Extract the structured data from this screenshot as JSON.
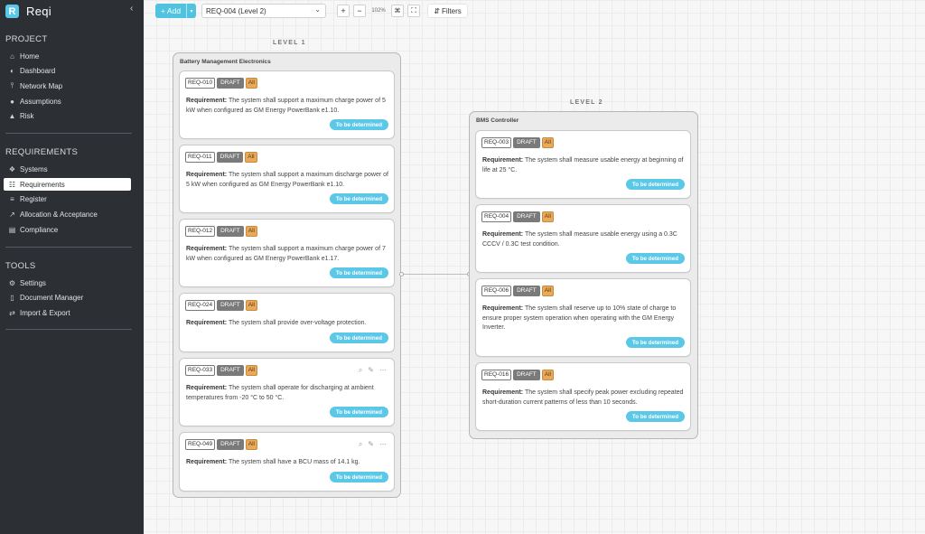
{
  "app": {
    "name": "Reqi",
    "logo_letter": "R"
  },
  "sidebar": {
    "collapse_icon": "chevron-left-icon",
    "sections": [
      {
        "title": "PROJECT",
        "items": [
          {
            "label": "Home",
            "icon": "home-icon"
          },
          {
            "label": "Dashboard",
            "icon": "dashboard-icon"
          },
          {
            "label": "Network Map",
            "icon": "network-map-icon"
          },
          {
            "label": "Assumptions",
            "icon": "lightbulb-icon"
          },
          {
            "label": "Risk",
            "icon": "warning-icon"
          }
        ]
      },
      {
        "title": "REQUIREMENTS",
        "items": [
          {
            "label": "Systems",
            "icon": "systems-icon"
          },
          {
            "label": "Requirements",
            "icon": "hierarchy-icon",
            "active": true
          },
          {
            "label": "Register",
            "icon": "list-icon"
          },
          {
            "label": "Allocation & Acceptance",
            "icon": "allocation-icon"
          },
          {
            "label": "Compliance",
            "icon": "compliance-icon"
          }
        ]
      },
      {
        "title": "TOOLS",
        "items": [
          {
            "label": "Settings",
            "icon": "gear-icon"
          },
          {
            "label": "Document Manager",
            "icon": "document-icon"
          },
          {
            "label": "Import & Export",
            "icon": "import-export-icon"
          }
        ]
      }
    ]
  },
  "toolbar": {
    "add_label": "Add",
    "selected_requirement": "REQ-004 (Level 2)",
    "zoom_in": "+",
    "zoom_out": "−",
    "zoom_level": "102%",
    "filters_label": "Filters"
  },
  "canvas": {
    "levels": [
      {
        "title": "LEVEL 1",
        "group_title": "Battery Management Electronics",
        "cards": [
          {
            "id": "REQ-010",
            "status": "DRAFT",
            "scope": "All",
            "req_label": "Requirement:",
            "text": "The system shall support a maximum charge power of 5 kW when configured as GM Energy PowerBank e1.10.",
            "verification": "To be determined"
          },
          {
            "id": "REQ-011",
            "status": "DRAFT",
            "scope": "All",
            "req_label": "Requirement:",
            "text": "The system shall support a maximum discharge power of 5 kW when configured as GM Energy PowerBank e1.10.",
            "verification": "To be determined"
          },
          {
            "id": "REQ-012",
            "status": "DRAFT",
            "scope": "All",
            "req_label": "Requirement:",
            "text": "The system shall support a maximum charge power of 7 kW when configured as GM Energy PowerBank e1.17.",
            "verification": "To be determined"
          },
          {
            "id": "REQ-024",
            "status": "DRAFT",
            "scope": "All",
            "req_label": "Requirement:",
            "text": "The system shall provide over-voltage protection.",
            "verification": "To be determined"
          },
          {
            "id": "REQ-033",
            "status": "DRAFT",
            "scope": "All",
            "req_label": "Requirement:",
            "text": "The system shall operate for discharging at ambient temperatures from -20 °C to 50 °C.",
            "verification": "To be determined",
            "show_actions": true
          },
          {
            "id": "REQ-049",
            "status": "DRAFT",
            "scope": "All",
            "req_label": "Requirement:",
            "text": "The system shall have a BCU mass of 14.1 kg.",
            "verification": "To be determined",
            "show_actions": true
          }
        ]
      },
      {
        "title": "LEVEL 2",
        "group_title": "BMS Controller",
        "cards": [
          {
            "id": "REQ-003",
            "status": "DRAFT",
            "scope": "All",
            "req_label": "Requirement:",
            "text": "The system shall measure usable energy at beginning of life at 25 °C.",
            "verification": "To be determined"
          },
          {
            "id": "REQ-004",
            "status": "DRAFT",
            "scope": "All",
            "req_label": "Requirement:",
            "text": "The system shall measure usable energy using a 0.3C CCCV / 0.3C test condition.",
            "verification": "To be determined"
          },
          {
            "id": "REQ-006",
            "status": "DRAFT",
            "scope": "All",
            "req_label": "Requirement:",
            "text": "The system shall reserve up to 10% state of charge to ensure proper system operation when operating with the GM Energy Inverter.",
            "verification": "To be determined"
          },
          {
            "id": "REQ-016",
            "status": "DRAFT",
            "scope": "All",
            "req_label": "Requirement:",
            "text": "The system shall specify peak power excluding repeated short-duration current patterns of less than 10 seconds.",
            "verification": "To be determined"
          }
        ]
      }
    ]
  },
  "colors": {
    "accent": "#5bc8e8",
    "sidebar_bg": "#2c3035",
    "draft": "#7a7a7a",
    "scope": "#e8a95a"
  }
}
